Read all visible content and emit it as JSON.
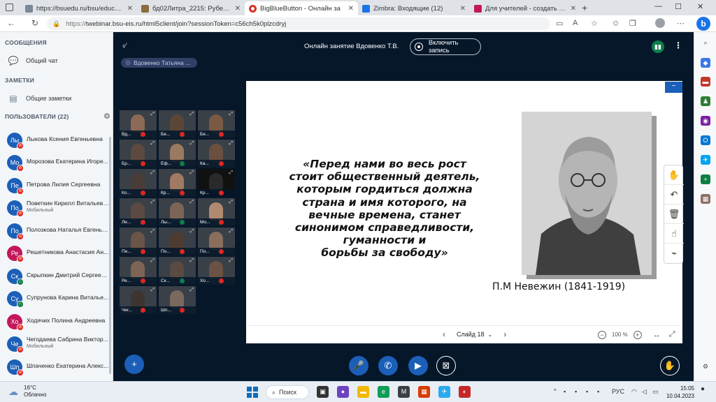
{
  "browser": {
    "tabs": [
      {
        "title": "https://bsuedu.ru/bsu/education",
        "color": "#7a8896",
        "active": false
      },
      {
        "title": "бд02Литра_2215: Рубежный ко",
        "color": "#8a6d3b",
        "active": false
      },
      {
        "title": "BigBlueButton - Онлайн за",
        "color": "#d93025",
        "active": true
      },
      {
        "title": "Zimbra: Входящие (12)",
        "color": "#1a73e8",
        "active": false
      },
      {
        "title": "Для учителей - создать тест дл",
        "color": "#c2185b",
        "active": false
      }
    ],
    "new_tab_glyph": "+",
    "url_scheme": "https://",
    "url_rest": "twebinar.bsu-eis.ru/html5client/join?sessionToken=c56ch5k0plzcdryj"
  },
  "sidebar": {
    "messages_header": "СООБЩЕНИЯ",
    "public_chat": "Общий чат",
    "notes_header": "ЗАМЕТКИ",
    "shared_notes": "Общие заметки",
    "users_header": "ПОЛЬЗОВАТЕЛИ (22)",
    "users": [
      {
        "initials": "Лы",
        "name": "Лыкова Ксения Евгеньевна",
        "sub": "",
        "mic": "muted"
      },
      {
        "initials": "Мо",
        "name": "Морозова Екатерина Игоре...",
        "sub": "",
        "mic": "muted"
      },
      {
        "initials": "Пе",
        "name": "Петрова Лилия Сергеевна",
        "sub": "",
        "mic": "muted"
      },
      {
        "initials": "По",
        "name": "Поветкин Кирилл Витальевич",
        "sub": "Мобильный",
        "mic": "muted"
      },
      {
        "initials": "По",
        "name": "Полозкова Наталья Евгенье...",
        "sub": "",
        "mic": "muted"
      },
      {
        "initials": "Ре",
        "name": "Решетникова Анастасия Ан...",
        "sub": "",
        "mic": "muted"
      },
      {
        "initials": "Ск",
        "name": "Скрыпкин Дмитрий Сергеев...",
        "sub": "",
        "mic": "listen"
      },
      {
        "initials": "Су",
        "name": "Супрунова Карина Виталье...",
        "sub": "",
        "mic": "listen"
      },
      {
        "initials": "Хо",
        "name": "Ходячих Полина Андреевна",
        "sub": "",
        "mic": "muted"
      },
      {
        "initials": "Че",
        "name": "Чегодаева Сабрина Виктор...",
        "sub": "Мобильный",
        "mic": "muted"
      },
      {
        "initials": "Шп",
        "name": "Шпаченко Екатерина Алекс...",
        "sub": "",
        "mic": "muted"
      }
    ]
  },
  "meeting": {
    "title": "Онлайн занятие Вдовенко Т.В.",
    "record_label": "Включить запись",
    "talking": "Вдовенко Татьяна ...",
    "videos": [
      {
        "label": "Вд...",
        "mic": "muted"
      },
      {
        "label": "Бе...",
        "mic": "muted"
      },
      {
        "label": "Бе...",
        "mic": "muted"
      },
      {
        "label": "Бр...",
        "mic": "muted"
      },
      {
        "label": "Еф...",
        "mic": "listen"
      },
      {
        "label": "Ка...",
        "mic": "muted"
      },
      {
        "label": "Ко...",
        "mic": "muted"
      },
      {
        "label": "Кр...",
        "mic": "muted"
      },
      {
        "label": "Кр...",
        "mic": "muted"
      },
      {
        "label": "Ле...",
        "mic": "muted"
      },
      {
        "label": "Лы...",
        "mic": "listen"
      },
      {
        "label": "Мо...",
        "mic": "muted"
      },
      {
        "label": "Пе...",
        "mic": "muted"
      },
      {
        "label": "По...",
        "mic": "muted"
      },
      {
        "label": "По...",
        "mic": "muted"
      },
      {
        "label": "Ре...",
        "mic": "muted"
      },
      {
        "label": "Ск...",
        "mic": "listen"
      },
      {
        "label": "Хо...",
        "mic": "muted"
      },
      {
        "label": "Чег...",
        "mic": "muted"
      },
      {
        "label": "Шп...",
        "mic": "muted"
      }
    ],
    "slide": {
      "quote_lines": [
        "«Перед нами во весь рост",
        "стоит общественный деятель,",
        "которым гордиться должна",
        "страна и имя которого, на",
        "вечные времена, станет",
        "синонимом справедливости,",
        "гуманности и",
        "борьбы за свободу»"
      ],
      "author": "П.М Невежин (1841-1919)"
    },
    "slide_label": "Слайд 18",
    "zoom_label": "100 %"
  },
  "taskbar": {
    "temperature": "16°C",
    "weather": "Облачно",
    "search_label": "Поиск",
    "language": "РУС",
    "time": "15:05",
    "date": "10.04.2023"
  },
  "colors": {
    "bbb_dark": "#06172a",
    "bbb_blue": "#1b5fb8",
    "muted_red": "#df2721",
    "listen_green": "#0f7f4c"
  }
}
